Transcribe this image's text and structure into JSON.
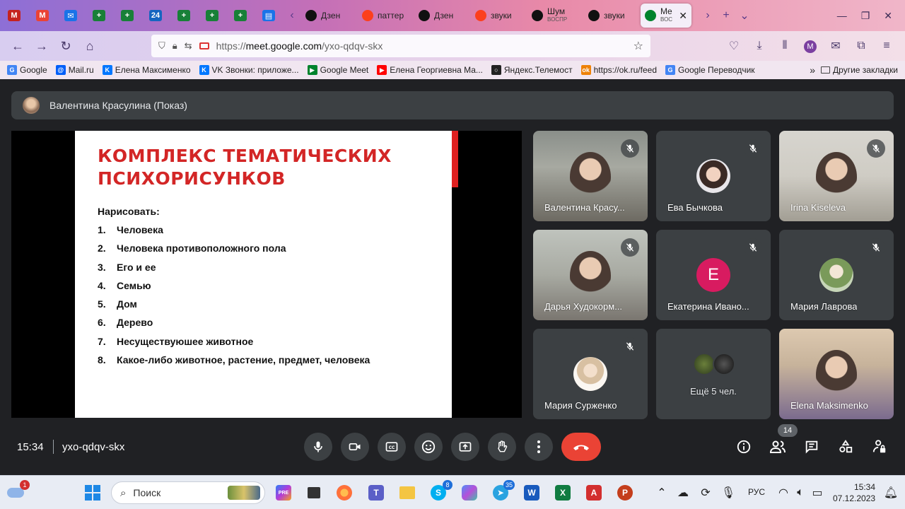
{
  "browser": {
    "pinned_tabs": [
      {
        "icon": "gmail-icon",
        "color": "#c5221f",
        "text": "M"
      },
      {
        "icon": "gmail-icon",
        "color": "#ea4335",
        "text": "M"
      },
      {
        "icon": "mail-icon",
        "color": "#1a73e8",
        "text": "✉"
      },
      {
        "icon": "sheets-plus-icon",
        "color": "#188038",
        "text": "+"
      },
      {
        "icon": "sheets-plus-icon",
        "color": "#188038",
        "text": "+"
      },
      {
        "icon": "number-24-icon",
        "color": "#1565c0",
        "text": "24"
      },
      {
        "icon": "sheets-plus-icon",
        "color": "#188038",
        "text": "+"
      },
      {
        "icon": "sheets-plus-icon",
        "color": "#188038",
        "text": "+"
      },
      {
        "icon": "sheets-plus-icon",
        "color": "#188038",
        "text": "+"
      },
      {
        "icon": "forms-icon",
        "color": "#1a73e8",
        "text": "▤"
      }
    ],
    "tabs": [
      {
        "label": "Дзен",
        "icon": "dzen-icon",
        "color": "#111111"
      },
      {
        "label": "паттер",
        "icon": "yandex-icon",
        "color": "#fc3f1d"
      },
      {
        "label": "Дзен",
        "icon": "dzen-icon",
        "color": "#111111"
      },
      {
        "label": "звуки",
        "icon": "yandex-icon",
        "color": "#fc3f1d"
      },
      {
        "label": "Шум",
        "icon": "play-icon",
        "color": "#111111"
      },
      {
        "label": "звуки",
        "icon": "play-icon",
        "color": "#111111"
      },
      {
        "label": "Me",
        "icon": "meet-icon",
        "color": "#00832d",
        "active": true
      }
    ],
    "tab5_sub": "ВОСПР",
    "tab7_sub": "ВОС",
    "url_host": "meet.google.com",
    "url_path": "/yxo-qdqv-skx",
    "url_scheme": "https://",
    "bookmarks": [
      {
        "label": "Google",
        "icon": "google-icon",
        "color": "#4285f4",
        "text": "G"
      },
      {
        "label": "Mail.ru",
        "icon": "at-icon",
        "color": "#005ff9",
        "text": "@"
      },
      {
        "label": "Елена Максименко",
        "icon": "vk-icon",
        "color": "#0077ff",
        "text": "K"
      },
      {
        "label": "VK Звонки: приложе...",
        "icon": "vk-icon",
        "color": "#0077ff",
        "text": "K"
      },
      {
        "label": "Google Meet",
        "icon": "meet-icon",
        "color": "#00832d",
        "text": "▶"
      },
      {
        "label": "Елена Георгиевна Ма...",
        "icon": "youtube-icon",
        "color": "#ff0000",
        "text": "▶"
      },
      {
        "label": "Яндекс.Телемост",
        "icon": "telemost-icon",
        "color": "#222222",
        "text": "○"
      },
      {
        "label": "https://ok.ru/feed",
        "icon": "ok-icon",
        "color": "#ee8208",
        "text": "ok"
      },
      {
        "label": "Google Переводчик",
        "icon": "translate-icon",
        "color": "#4285f4",
        "text": "G"
      }
    ],
    "other_bookmarks": "Другие закладки"
  },
  "meet": {
    "presenter": "Валентина Красулина (Показ)",
    "slide": {
      "title": "КОМПЛЕКС ТЕМАТИЧЕСКИХ ПСИХОРИСУНКОВ",
      "intro": "Нарисовать:",
      "items": [
        {
          "n": "1.",
          "text": "Человека"
        },
        {
          "n": "2.",
          "text": "Человека противоположного пола"
        },
        {
          "n": "3.",
          "text": "Его и ее"
        },
        {
          "n": "4.",
          "text": "Семью"
        },
        {
          "n": "5.",
          "text": "Дом"
        },
        {
          "n": "6.",
          "text": "Дерево"
        },
        {
          "n": "7.",
          "text": "Несуществуюшее животное"
        },
        {
          "n": "8.",
          "text": "Какое-либо животное, растение, предмет, человека"
        }
      ]
    },
    "participants": [
      {
        "name": "Валентина Красу...",
        "kind": "video",
        "muted": true
      },
      {
        "name": "Ева Бычкова",
        "kind": "avatar",
        "muted": true
      },
      {
        "name": "Irina Kiseleva",
        "kind": "video",
        "muted": true
      },
      {
        "name": "Дарья Худокорм...",
        "kind": "video",
        "muted": true
      },
      {
        "name": "Екатерина Ивано...",
        "kind": "letter",
        "letter": "Е",
        "muted": true
      },
      {
        "name": "Мария Лаврова",
        "kind": "avatar",
        "muted": true
      },
      {
        "name": "Мария Сурженко",
        "kind": "avatar",
        "muted": true
      },
      {
        "name": "Ещё 5 чел.",
        "kind": "more"
      },
      {
        "name": "Elena Maksimenko",
        "kind": "video",
        "muted": false
      }
    ],
    "time": "15:34",
    "code": "yxo-qdqv-skx",
    "people_count": "14",
    "colors": {
      "hangup": "#ea4335",
      "control_bg": "#3c4043",
      "letter_avatar": "#d81b60"
    }
  },
  "taskbar": {
    "weather_badge": "1",
    "search_placeholder": "Поиск",
    "skype_badge": "8",
    "telegram_badge": "35",
    "lang": "РУС",
    "time": "15:34",
    "date": "07.12.2023"
  }
}
